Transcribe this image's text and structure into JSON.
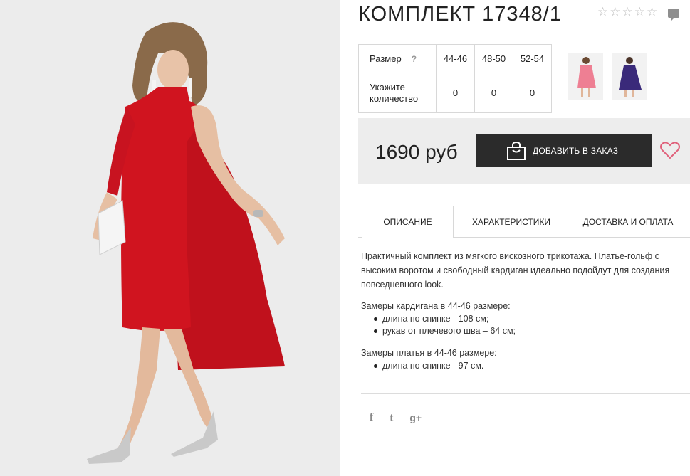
{
  "product": {
    "title": "КОМПЛЕКТ 17348/1",
    "rating_stars": 5,
    "comments_count": ""
  },
  "sizes": {
    "size_label": "Размер",
    "help_symbol": "?",
    "qty_label": "Укажите количество",
    "columns": [
      "44-46",
      "48-50",
      "52-54"
    ],
    "quantities": [
      "0",
      "0",
      "0"
    ]
  },
  "thumbnails": [
    "thumbnail-pink",
    "thumbnail-purple"
  ],
  "purchase": {
    "price": "1690 руб",
    "add_button_label": "ДОБАВИТЬ В ЗАКАЗ"
  },
  "tabs": [
    {
      "label": "ОПИСАНИЕ",
      "active": true
    },
    {
      "label": "ХАРАКТЕРИСТИКИ",
      "active": false
    },
    {
      "label": "ДОСТАВКА И ОПЛАТА",
      "active": false
    }
  ],
  "description": {
    "intro": "Практичный комплект из мягкого вискозного трикотажа. Платье-гольф с высоким воротом и свободный кардиган идеально подойдут для создания повседневного look.",
    "cardigan_heading": "Замеры кардигана в 44-46 размере:",
    "cardigan_items": [
      "длина по спинке - 108 см;",
      "рукав от плечевого шва – 64 см;"
    ],
    "dress_heading": "Замеры платья в 44-46 размере:",
    "dress_items": [
      "длина по спинке - 97 см."
    ]
  },
  "social": {
    "facebook": "f",
    "twitter": "t",
    "googleplus": "g+"
  },
  "colors": {
    "dress_red": "#d0141f",
    "button_dark": "#2b2b2b",
    "heart_pink": "#e0607a",
    "panel_grey": "#ededed"
  }
}
